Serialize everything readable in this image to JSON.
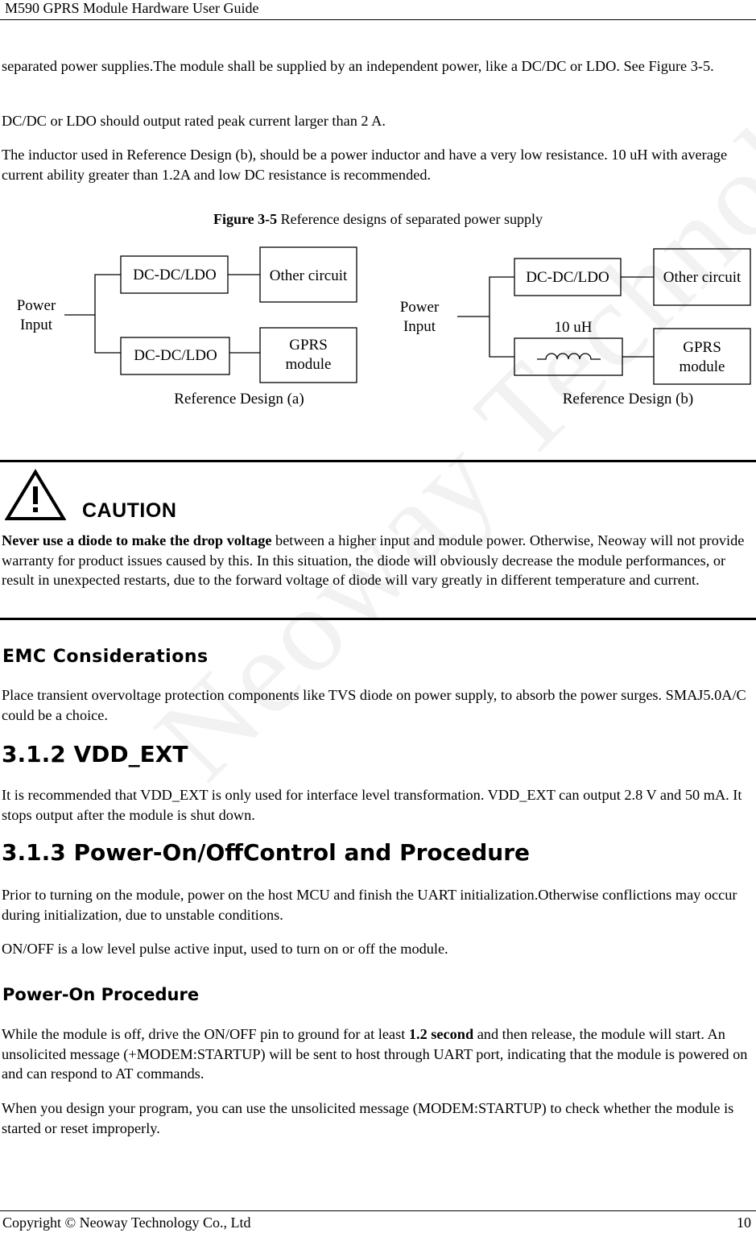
{
  "header": {
    "title": "M590 GPRS Module Hardware User Guide"
  },
  "watermark": "Neoway Technology",
  "intro": {
    "p1": "separated power supplies.The module shall be supplied by an independent power, like a DC/DC or LDO. See Figure 3-5.",
    "p2": "DC/DC or LDO should output rated peak current larger than 2 A.",
    "p3": "The inductor used in Reference Design (b), should be a power inductor and have a very low resistance. 10 uH with average current ability greater than 1.2A and low DC resistance is recommended."
  },
  "figure": {
    "label": "Figure 3-5",
    "caption": " Reference designs of separated power supply",
    "design_a": {
      "power_input_line1": "Power",
      "power_input_line2": "Input",
      "top_block": "DC-DC/LDO",
      "bottom_block": "DC-DC/LDO",
      "other_circuit": "Other circuit",
      "gprs_line1": "GPRS",
      "gprs_line2": "module",
      "title": "Reference Design (a)"
    },
    "design_b": {
      "power_input_line1": "Power",
      "power_input_line2": "Input",
      "top_block": "DC-DC/LDO",
      "inductor_label": "10 uH",
      "other_circuit": "Other circuit",
      "gprs_line1": "GPRS",
      "gprs_line2": "module",
      "title": "Reference Design (b)"
    }
  },
  "caution": {
    "label": "CAUTION",
    "bold_text": "Never use a diode to make the drop voltage",
    "text": " between a higher input and module power. Otherwise, Neoway will not provide warranty for product issues caused by this. In this situation, the diode will obviously decrease the module performances, or result in unexpected restarts, due to the forward voltage of diode will vary greatly in different temperature and current."
  },
  "emc": {
    "heading": "EMC Considerations",
    "text": "Place transient overvoltage protection components like TVS diode on power supply, to absorb the power surges. SMAJ5.0A/C could be a choice."
  },
  "vdd_ext": {
    "heading": "3.1.2 VDD_EXT",
    "text": "It is recommended that VDD_EXT is only used for interface level transformation. VDD_EXT can output 2.8 V and 50 mA. It stops output after the module is shut down."
  },
  "power_control": {
    "heading": "3.1.3 Power-On/OffControl and Procedure",
    "p1": "Prior to turning on the module, power on the host MCU and finish the UART initialization.Otherwise conflictions may occur during initialization, due to unstable conditions.",
    "p2": "ON/OFF is a low level pulse active input, used to turn on or off the module."
  },
  "power_on": {
    "heading": "Power-On Procedure",
    "p1_pre": "While the module is off, drive the ON/OFF pin to ground for at least ",
    "p1_bold": "1.2 second",
    "p1_post": " and then release, the module will start. An unsolicited message (+MODEM:STARTUP) will be sent to host through UART port, indicating that the module is powered on and can respond to AT commands.",
    "p2": "When you design your program, you can use the unsolicited message (MODEM:STARTUP) to check whether the module is started or reset improperly."
  },
  "footer": {
    "copyright": "Copyright © Neoway Technology Co., Ltd",
    "page_number": "10"
  }
}
